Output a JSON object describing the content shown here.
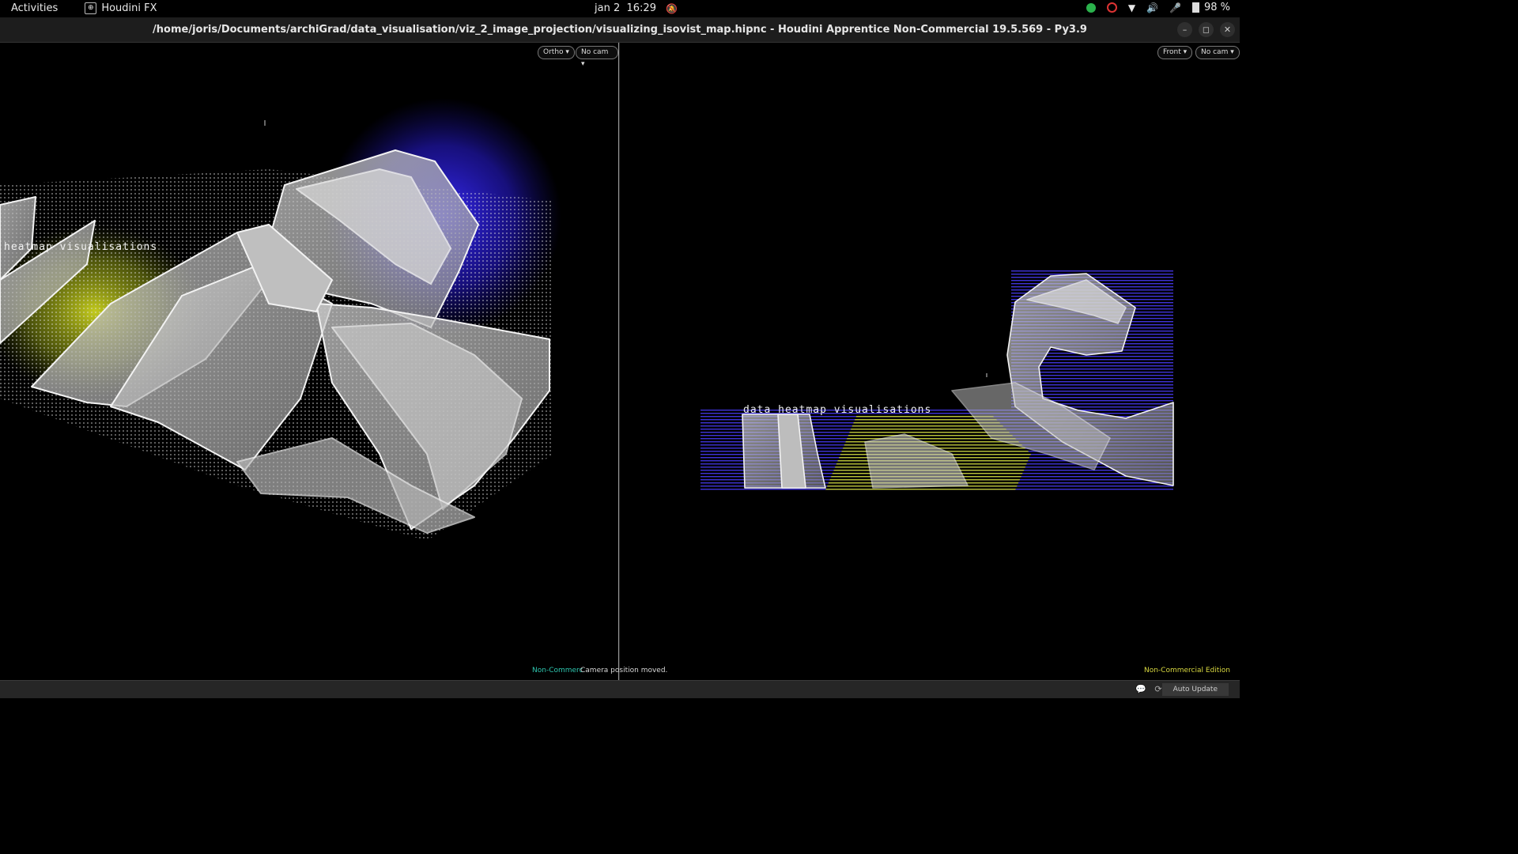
{
  "topbar": {
    "activities": "Activities",
    "app_name": "Houdini FX",
    "date": "jan 2",
    "time": "16:29",
    "battery": "98 %",
    "icons": [
      "whatsapp-icon",
      "chrome-icon",
      "wifi-icon",
      "volume-icon",
      "microphone-icon",
      "battery-icon"
    ]
  },
  "window": {
    "title": "/home/joris/Documents/archiGrad/data_visualisation/viz_2_image_projection/visualizing_isovist_map.hipnc - Houdini Apprentice Non-Commercial 19.5.569 - Py3.9"
  },
  "viewport_left": {
    "projection_menu": "Ortho",
    "camera_menu": "No cam",
    "overlay_label": "heatmap visualisations"
  },
  "viewport_right": {
    "projection_menu": "Front",
    "camera_menu": "No cam",
    "overlay_label": "data heatmap visualisations"
  },
  "status": {
    "non_commercial_left": "Non-Commerc",
    "message": "Camera position moved.",
    "non_commercial_right": "Non-Commercial Edition"
  },
  "bottombar": {
    "auto_update": "Auto Update"
  },
  "colors": {
    "heat_blue": "#2a20d8",
    "heat_yellow": "#c8d420",
    "geometry_fill": "#d8d8d8",
    "accent_teal": "#2ec7b0",
    "accent_yellow": "#d8d840"
  }
}
